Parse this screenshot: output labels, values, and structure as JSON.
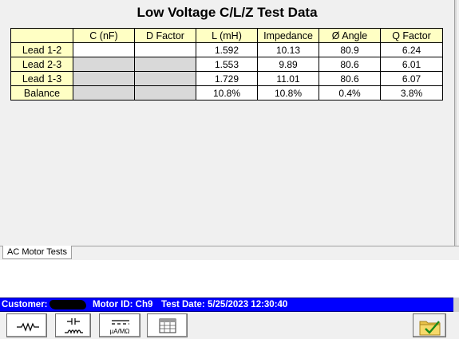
{
  "title": "Low Voltage C/L/Z Test Data",
  "table": {
    "columns": [
      "",
      "C (nF)",
      "D Factor",
      "L (mH)",
      "Impedance",
      "Ø Angle",
      "Q Factor"
    ],
    "rows": [
      {
        "label": "Lead 1-2",
        "cells": [
          "",
          "",
          "1.592",
          "10.13",
          "80.9",
          "6.24"
        ]
      },
      {
        "label": "Lead 2-3",
        "cells": [
          "",
          "",
          "1.553",
          "9.89",
          "80.6",
          "6.01"
        ]
      },
      {
        "label": "Lead 1-3",
        "cells": [
          "",
          "",
          "1.729",
          "11.01",
          "80.6",
          "6.07"
        ]
      },
      {
        "label": "Balance",
        "cells": [
          "",
          "",
          "10.8%",
          "10.8%",
          "0.4%",
          "3.8%"
        ]
      }
    ]
  },
  "tabs": {
    "active": "AC Motor Tests"
  },
  "status": {
    "customer_label": "Customer:",
    "motor_id": "Motor ID: Ch9",
    "test_date": "Test Date: 5/25/2023 12:30:40"
  },
  "toolbar": {
    "buttons": [
      {
        "icon": "resistor-icon"
      },
      {
        "icon": "capacitor-inductor-icon"
      },
      {
        "icon": "meter-icon",
        "label": "µA/MΩ"
      },
      {
        "icon": "table-icon"
      },
      {
        "icon": "folder-check-icon"
      }
    ]
  },
  "colors": {
    "header_bg": "#ffffc4",
    "status_bg": "#0000ff",
    "disabled_cell": "#d9d9d9"
  }
}
